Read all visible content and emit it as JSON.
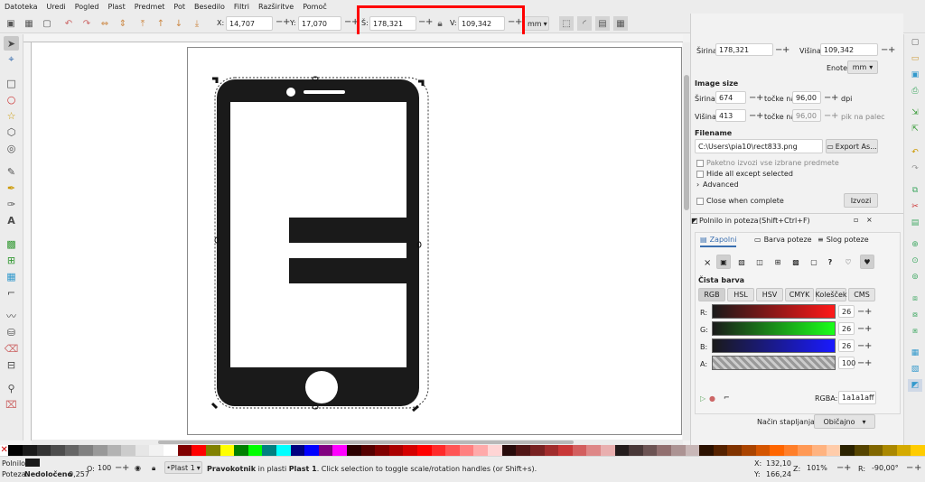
{
  "menu": [
    "Datoteka",
    "Uredi",
    "Pogled",
    "Plast",
    "Predmet",
    "Pot",
    "Besedilo",
    "Filtri",
    "Razširitve",
    "Pomoč"
  ],
  "toolbar": {
    "x_label": "X:",
    "x_value": "14,707",
    "y_label": "Y:",
    "y_value": "17,070",
    "w_label": "Š:",
    "w_value": "178,321",
    "h_label": "V:",
    "h_value": "109,342",
    "unit": "mm"
  },
  "export": {
    "width_label": "Širina:",
    "width_value": "178,321",
    "height_label": "Višina:",
    "height_value": "109,342",
    "units_label": "Enote:",
    "units_value": "mm",
    "image_size_title": "Image size",
    "img_width_label": "Širina:",
    "img_width_value": "674",
    "img_height_label": "Višina:",
    "img_height_value": "413",
    "dpi_at_label": "točke na",
    "dpi_value": "96,00",
    "dpi_unit": "dpi",
    "dpi2_value": "96,00",
    "dpi2_unit": "pik na palec",
    "filename_title": "Filename",
    "filename_value": "C:\\Users\\pia10\\rect833.png",
    "export_as_label": "Export As...",
    "batch_label": "Paketno izvozi vse izbrane predmete",
    "hide_label": "Hide all except selected",
    "advanced_label": "Advanced",
    "close_label": "Close when complete",
    "export_button": "Izvozi"
  },
  "fill_stroke": {
    "title": "Polnilo in poteza",
    "shortcut": "(Shift+Ctrl+F)",
    "tabs": [
      "Zapolni",
      "Barva poteze",
      "Slog poteze"
    ],
    "flat_color_title": "Čista barva",
    "modes": [
      "RGB",
      "HSL",
      "HSV",
      "CMYK",
      "Kolešček",
      "CMS"
    ],
    "channels": [
      {
        "label": "R:",
        "value": "26"
      },
      {
        "label": "G:",
        "value": "26"
      },
      {
        "label": "B:",
        "value": "26"
      },
      {
        "label": "A:",
        "value": "100"
      }
    ],
    "rgba_label": "RGBA:",
    "rgba_value": "1a1a1aff",
    "blend_label": "Način stapljanja:",
    "blend_value": "Običajno"
  },
  "status": {
    "fill_label": "Polnilo:",
    "stroke_label": "Poteza:",
    "stroke_value": "Nedoločeno",
    "stroke_width": "0,257",
    "opacity_label": "O:",
    "opacity_value": "100",
    "layer_value": "•Plast 1",
    "message_bold": "Pravokotnik",
    "message_mid": " in plasti ",
    "message_layer": "Plast 1",
    "message_rest": ". Click selection to toggle scale/rotation handles (or Shift+s).",
    "x_label": "X:",
    "x_value": "132,10",
    "y_label": "Y:",
    "y_value": "166,24",
    "z_label": "Z:",
    "zoom_value": "101%",
    "r_label": "R:",
    "rotation_value": "-90,00°"
  },
  "colors": {
    "fill": "#1a1a1a",
    "highlight": "#ff0000",
    "accent": "#3a6fb0"
  }
}
